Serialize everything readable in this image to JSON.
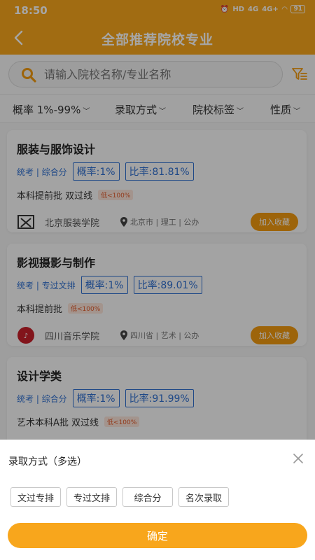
{
  "status_bar": {
    "time": "18:50",
    "network_1": "HD",
    "network_2": "4G",
    "network_3": "4G+",
    "battery": "91"
  },
  "header": {
    "title": "全部推荐院校专业"
  },
  "search": {
    "placeholder": "请输入院校名称/专业名称",
    "value": ""
  },
  "filters": [
    {
      "label": "概率 1%-99%"
    },
    {
      "label": "录取方式"
    },
    {
      "label": "院校标签"
    },
    {
      "label": "性质"
    }
  ],
  "cards": [
    {
      "major": "服装与服饰设计",
      "tag": "统考 | 综合分",
      "probability": "概率:1%",
      "ratio": "比率:81.81%",
      "batch": "本科提前批  双过线",
      "low_badge": "低<100%",
      "school": "北京服装学院",
      "meta": "北京市 | 理工 | 公办",
      "fav_label": "加入收藏"
    },
    {
      "major": "影视摄影与制作",
      "tag": "统考 | 专过文排",
      "probability": "概率:1%",
      "ratio": "比率:89.01%",
      "batch": "本科提前批",
      "low_badge": "低<100%",
      "school": "四川音乐学院",
      "meta": "四川省 | 艺术 | 公办",
      "fav_label": "加入收藏"
    },
    {
      "major": "设计学类",
      "tag": "统考 | 综合分",
      "probability": "概率:1%",
      "ratio": "比率:91.99%",
      "batch": "艺术本科A批  双过线",
      "low_badge": "低<100%"
    }
  ],
  "sheet": {
    "title": "录取方式（多选）",
    "options": [
      "文过专排",
      "专过文排",
      "综合分",
      "名次录取"
    ],
    "confirm_label": "确定"
  },
  "colors": {
    "primary": "#f8a61c",
    "accent_blue": "#2f6fd0",
    "button_orange": "#f29a10"
  },
  "icons": [
    "back-arrow-icon",
    "search-icon",
    "filter-funnel-icon",
    "chevron-down-icon",
    "location-pin-icon",
    "close-icon"
  ]
}
